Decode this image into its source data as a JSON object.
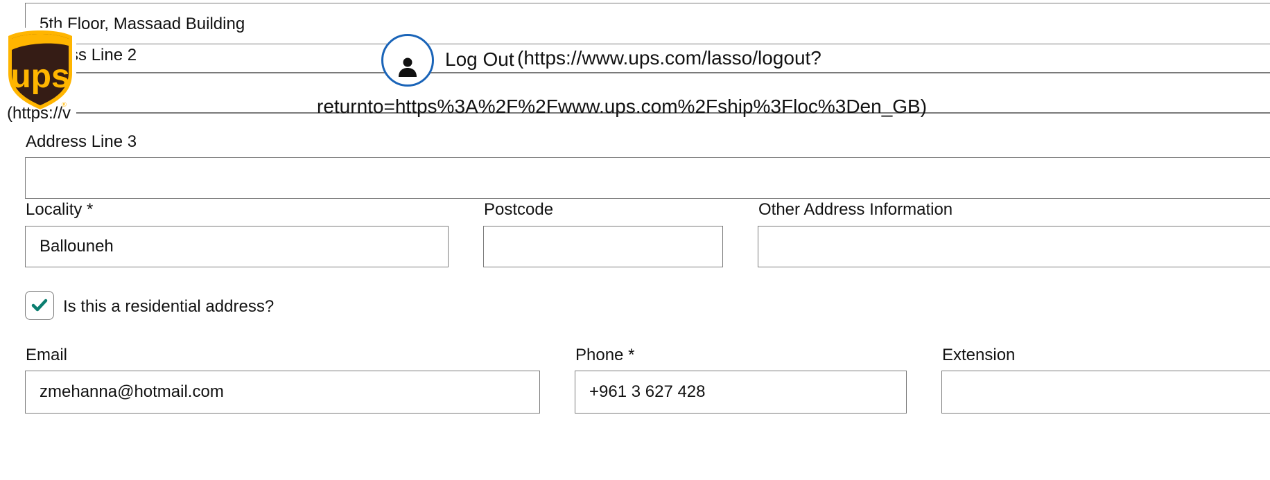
{
  "address": {
    "line1_value": "5th Floor, Massaad Building",
    "line2_label": "Address Line 2",
    "line3_label": "Address Line 3",
    "line3_value": ""
  },
  "header_overlay": {
    "logo_alt": "UPS",
    "logo_link_text": "(https://v",
    "logout_label": "Log Out",
    "logout_url_part1": "(https://www.ups.com/lasso/logout?",
    "logout_url_part2": "returnto=https%3A%2F%2Fwww.ups.com%2Fship%3Floc%3Den_GB)",
    "user_icon": "user-icon",
    "logo_colors": {
      "brown": "#351c15",
      "gold": "#ffb500"
    },
    "accent_blue": "#1a64b8"
  },
  "locality": {
    "label": "Locality *",
    "value": "Ballouneh"
  },
  "postcode": {
    "label": "Postcode",
    "value": ""
  },
  "other_info": {
    "label": "Other Address Information",
    "value": ""
  },
  "residential": {
    "label": "Is this a residential address?",
    "checked": true,
    "check_color": "#0a7e70"
  },
  "email": {
    "label": "Email",
    "value": "zmehanna@hotmail.com"
  },
  "phone": {
    "label": "Phone *",
    "value": "+961 3 627 428"
  },
  "extension": {
    "label": "Extension",
    "value": ""
  }
}
